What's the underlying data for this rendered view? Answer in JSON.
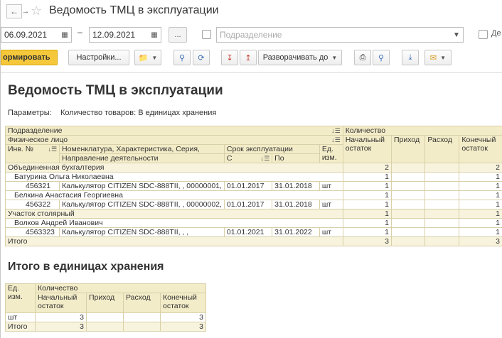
{
  "window": {
    "title": "Ведомость ТМЦ в эксплуатации"
  },
  "filters": {
    "date_from": "06.09.2021",
    "date_to": "12.09.2021",
    "separator": "–",
    "period_button": "...",
    "division_placeholder": "Подразделение",
    "extra_checkbox_label": "Де"
  },
  "toolbar": {
    "generate": "ормировать",
    "settings": "Настройки...",
    "expand_to": "Разворачивать до"
  },
  "report": {
    "title": "Ведомость ТМЦ в эксплуатации",
    "params_label": "Параметры:",
    "params_value": "Количество товаров: В единицах хранения",
    "headers": {
      "division": "Подразделение",
      "quantity": "Количество",
      "person": "Физическое лицо",
      "opening": "Начальный остаток",
      "income": "Приход",
      "expense": "Расход",
      "closing": "Конечный остаток",
      "inv_no": "Инв. №",
      "nomenclature": "Номенклатура, Характеристика, Серия,",
      "activity": "Направление деятельности",
      "exploitation": "Срок эксплуатации",
      "from": "С",
      "to": "По",
      "unit": "Ед. изм."
    },
    "rows": [
      {
        "kind": "division",
        "label": "Объединенная бухгалтерия",
        "opening": "",
        "income": "",
        "expense": "",
        "closing": "",
        "num1": "2",
        "num2": "2"
      },
      {
        "kind": "person",
        "label": "Батурина Ольга Николаевна",
        "num1": "1",
        "num2": "1"
      },
      {
        "kind": "item",
        "inv": "456321",
        "name": "Калькулятор CITIZEN SDC-888TII, , 00000001,",
        "from": "01.01.2017",
        "to": "31.01.2018",
        "unit": "шт",
        "num1": "1",
        "num2": "1"
      },
      {
        "kind": "person",
        "label": "Белкина Анастасия Георгиевна",
        "num1": "1",
        "num2": "1"
      },
      {
        "kind": "item",
        "inv": "456322",
        "name": "Калькулятор CITIZEN SDC-888TII, , 00000002,",
        "from": "01.01.2017",
        "to": "31.01.2018",
        "unit": "шт",
        "num1": "1",
        "num2": "1"
      },
      {
        "kind": "division",
        "label": "Участок столярный",
        "num1": "1",
        "num2": "1"
      },
      {
        "kind": "person",
        "label": "Волков Андрей Иванович",
        "num1": "1",
        "num2": "1"
      },
      {
        "kind": "item",
        "inv": "4563323",
        "name": "Калькулятор CITIZEN SDC-888TII, , ,",
        "from": "01.01.2021",
        "to": "31.01.2022",
        "unit": "шт",
        "num1": "1",
        "num2": "1"
      }
    ],
    "total_label": "Итого",
    "total_opening": "3",
    "total_closing": "3"
  },
  "summary": {
    "title": "Итого в единицах хранения",
    "headers": {
      "unit": "Ед. изм.",
      "quantity": "Количество",
      "opening": "Начальный остаток",
      "income": "Приход",
      "expense": "Расход",
      "closing": "Конечный остаток"
    },
    "row_unit": "шт",
    "row_opening": "3",
    "row_closing": "3",
    "total_label": "Итого",
    "total_opening": "3",
    "total_closing": "3"
  }
}
